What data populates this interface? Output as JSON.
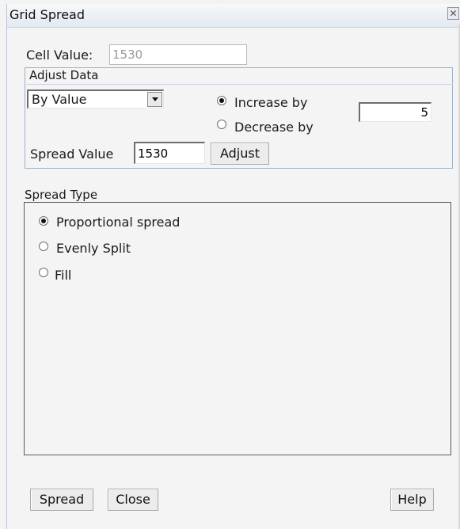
{
  "window": {
    "title": "Grid Spread",
    "close_label": "✕"
  },
  "cell_value": {
    "label": "Cell Value:",
    "value": "1530"
  },
  "adjust_data": {
    "legend": "Adjust Data",
    "mode_select": {
      "selected": "By Value"
    },
    "direction_options": [
      {
        "label": "Increase by",
        "checked": true
      },
      {
        "label": "Decrease by",
        "checked": false
      }
    ],
    "amount": "5",
    "spread_value_label": "Spread Value",
    "spread_value": "1530",
    "adjust_button": "Adjust"
  },
  "spread_type": {
    "legend": "Spread Type",
    "options": [
      {
        "label": "Proportional spread",
        "checked": true
      },
      {
        "label": "Evenly Split",
        "checked": false
      },
      {
        "label": "Fill",
        "checked": false
      }
    ]
  },
  "footer": {
    "spread_button": "Spread",
    "close_button": "Close",
    "help_button": "Help"
  }
}
